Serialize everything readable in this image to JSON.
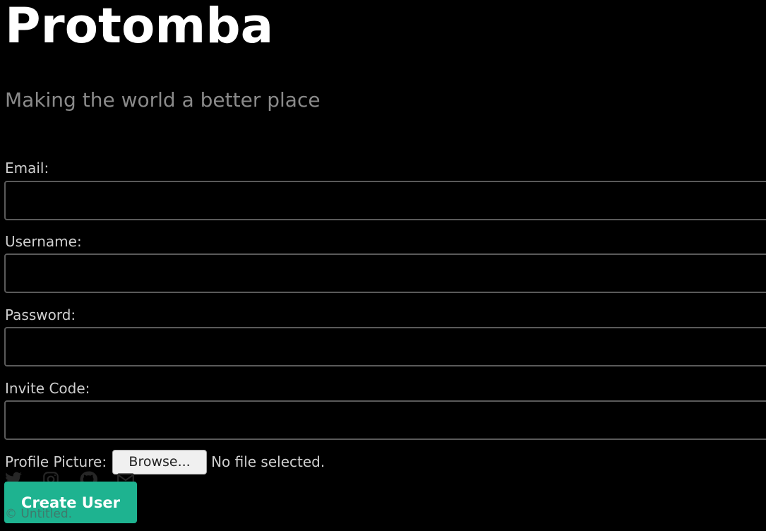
{
  "header": {
    "title": "Protomba",
    "tagline": "Making the world a better place"
  },
  "form": {
    "email_label": "Email:",
    "email_value": "",
    "username_label": "Username:",
    "username_value": "",
    "password_label": "Password:",
    "password_value": "",
    "invite_label": "Invite Code:",
    "invite_value": "",
    "profile_picture_label": "Profile Picture:",
    "browse_label": "Browse...",
    "file_status": "No file selected.",
    "submit_label": "Create User"
  },
  "footer": {
    "social_icons": [
      "twitter-icon",
      "instagram-icon",
      "github-icon",
      "mail-icon"
    ],
    "copyright": "© Untitled."
  },
  "colors": {
    "background": "#000000",
    "accent": "#1eb390",
    "input_border": "#5a5a5a",
    "label_text": "#cfcfcf",
    "tagline_text": "#8a8a8a"
  }
}
